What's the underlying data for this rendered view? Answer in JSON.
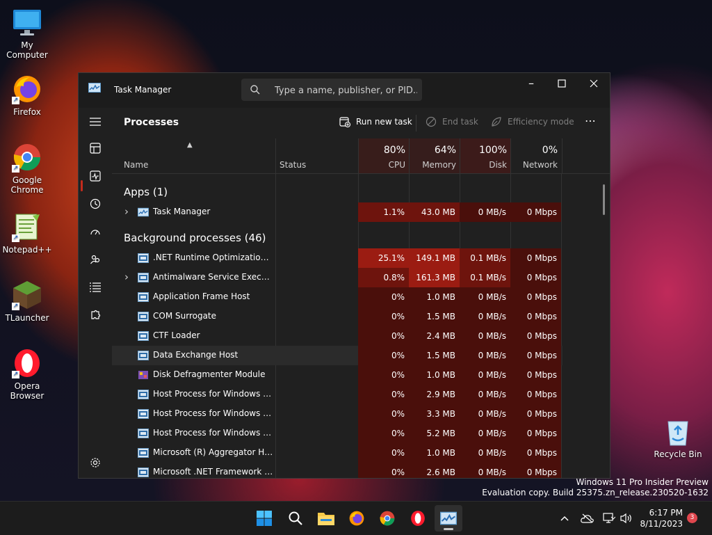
{
  "desktop": {
    "icons": [
      {
        "label": "My Computer",
        "icon": "monitor-icon"
      },
      {
        "label": "Firefox",
        "icon": "firefox-icon"
      },
      {
        "label": "Google Chrome",
        "icon": "chrome-icon"
      },
      {
        "label": "Notepad++",
        "icon": "notepadpp-icon"
      },
      {
        "label": "TLauncher",
        "icon": "grass-block-icon"
      },
      {
        "label": "Opera Browser",
        "icon": "opera-icon"
      },
      {
        "label": "Recycle Bin",
        "icon": "recycle-bin-icon"
      }
    ],
    "watermark": {
      "line1": "Windows 11 Pro Insider Preview",
      "line2": "Evaluation copy. Build 25375.zn_release.230520-1632"
    }
  },
  "window": {
    "title": "Task Manager",
    "search_placeholder": "Type a name, publisher, or PID...",
    "page_title": "Processes",
    "commands": {
      "run_new_task": "Run new task",
      "end_task": "End task",
      "efficiency_mode": "Efficiency mode",
      "more": "⋯"
    },
    "columns": {
      "name": "Name",
      "status": "Status",
      "cpu": {
        "pct": "80%",
        "label": "CPU"
      },
      "memory": {
        "pct": "64%",
        "label": "Memory"
      },
      "disk": {
        "pct": "100%",
        "label": "Disk"
      },
      "network": {
        "pct": "0%",
        "label": "Network"
      }
    },
    "header_heat": {
      "cpu": 0.8,
      "memory": 0.64,
      "disk": 1.0,
      "network": 0.0
    },
    "groups": {
      "apps": "Apps (1)",
      "background": "Background processes (46)"
    },
    "apps": [
      {
        "name": "Task Manager",
        "cpu": "1.1%",
        "memory": "43.0 MB",
        "disk": "0 MB/s",
        "network": "0 Mbps",
        "expandable": true
      }
    ],
    "processes": [
      {
        "name": ".NET Runtime Optimization Se...",
        "cpu": "25.1%",
        "memory": "149.1 MB",
        "disk": "0.1 MB/s",
        "network": "0 Mbps",
        "expandable": false
      },
      {
        "name": "Antimalware Service Executable",
        "cpu": "0.8%",
        "memory": "161.3 MB",
        "disk": "0.1 MB/s",
        "network": "0 Mbps",
        "expandable": true
      },
      {
        "name": "Application Frame Host",
        "cpu": "0%",
        "memory": "1.0 MB",
        "disk": "0 MB/s",
        "network": "0 Mbps",
        "expandable": false
      },
      {
        "name": "COM Surrogate",
        "cpu": "0%",
        "memory": "1.5 MB",
        "disk": "0 MB/s",
        "network": "0 Mbps",
        "expandable": false
      },
      {
        "name": "CTF Loader",
        "cpu": "0%",
        "memory": "2.4 MB",
        "disk": "0 MB/s",
        "network": "0 Mbps",
        "expandable": false
      },
      {
        "name": "Data Exchange Host",
        "cpu": "0%",
        "memory": "1.5 MB",
        "disk": "0 MB/s",
        "network": "0 Mbps",
        "expandable": false
      },
      {
        "name": "Disk Defragmenter Module",
        "cpu": "0%",
        "memory": "1.0 MB",
        "disk": "0 MB/s",
        "network": "0 Mbps",
        "expandable": false
      },
      {
        "name": "Host Process for Windows Tasks",
        "cpu": "0%",
        "memory": "2.9 MB",
        "disk": "0 MB/s",
        "network": "0 Mbps",
        "expandable": false
      },
      {
        "name": "Host Process for Windows Tasks",
        "cpu": "0%",
        "memory": "3.3 MB",
        "disk": "0 MB/s",
        "network": "0 Mbps",
        "expandable": false
      },
      {
        "name": "Host Process for Windows Tasks",
        "cpu": "0%",
        "memory": "5.2 MB",
        "disk": "0 MB/s",
        "network": "0 Mbps",
        "expandable": false
      },
      {
        "name": "Microsoft (R) Aggregator Host",
        "cpu": "0%",
        "memory": "1.0 MB",
        "disk": "0 MB/s",
        "network": "0 Mbps",
        "expandable": false
      },
      {
        "name": "Microsoft .NET Framework op...",
        "cpu": "0%",
        "memory": "2.6 MB",
        "disk": "0 MB/s",
        "network": "0 Mbps",
        "expandable": false
      }
    ]
  },
  "taskbar": {
    "apps": [
      "start-icon",
      "search-icon",
      "file-explorer-icon",
      "firefox-icon",
      "chrome-icon",
      "opera-icon",
      "task-manager-icon"
    ],
    "clock": {
      "time": "6:17 PM",
      "date": "8/11/2023"
    },
    "notification_count": "3"
  },
  "colors": {
    "accent": "#c42b1c",
    "heat_high": "#9b1c12",
    "heat_mid": "#6e140d",
    "heat_low": "#4a0f0b"
  }
}
